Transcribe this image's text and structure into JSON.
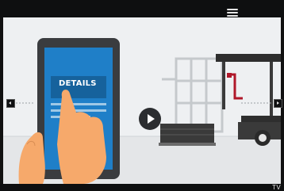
{
  "toolbar": {
    "menu_icon": "hamburger-menu-icon"
  },
  "illustration": {
    "tablet_heading": "DETAILS",
    "accent": "#1f7fc8",
    "truck_accent": "#b0182a"
  },
  "controls": {
    "play_icon": "play-icon",
    "prev_icon": "chevron-left-icon",
    "next_icon": "chevron-right-icon"
  },
  "footer": {
    "tv_label": "TV"
  }
}
